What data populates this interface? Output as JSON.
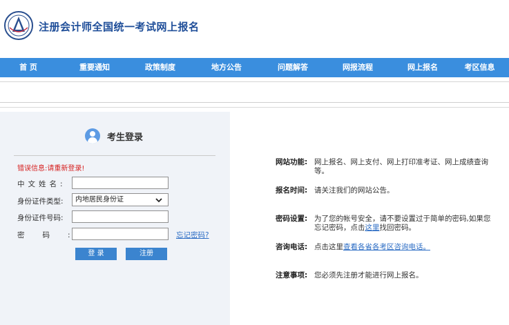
{
  "header": {
    "title": "注册会计师全国统一考试网上报名"
  },
  "nav": [
    "首 页",
    "重要通知",
    "政策制度",
    "地方公告",
    "问题解答",
    "网报流程",
    "网上报名",
    "考区信息"
  ],
  "login": {
    "title": "考生登录",
    "error_label": "错误信息:",
    "error_msg": "请重新登录!",
    "name_label": "中文姓名:",
    "id_type_label": "身份证件类型:",
    "id_type_value": "内地居民身份证",
    "id_number_label": "身份证件号码:",
    "password_label": "密码:",
    "forgot_link": "忘记密码?",
    "login_button": "登 录",
    "register_button": "注册"
  },
  "info": {
    "function_label": "网站功能:",
    "function_text": "网上报名、网上支付、网上打印准考证、网上成绩查询等。",
    "time_label": "报名时间:",
    "time_text": "请关注我们的网站公告。",
    "password_label": "密码设置:",
    "password_text_1": "为了您的帐号安全，请不要设置过于简单的密码,如果您忘记密码，点击",
    "password_link": "这里",
    "password_text_2": "找回密码。",
    "phone_label": "咨询电话:",
    "phone_text_1": "点击这里",
    "phone_link": "查看各省各考区咨询电话。",
    "notice_label": "注意事项:",
    "notice_text": "您必须先注册才能进行网上报名。"
  }
}
